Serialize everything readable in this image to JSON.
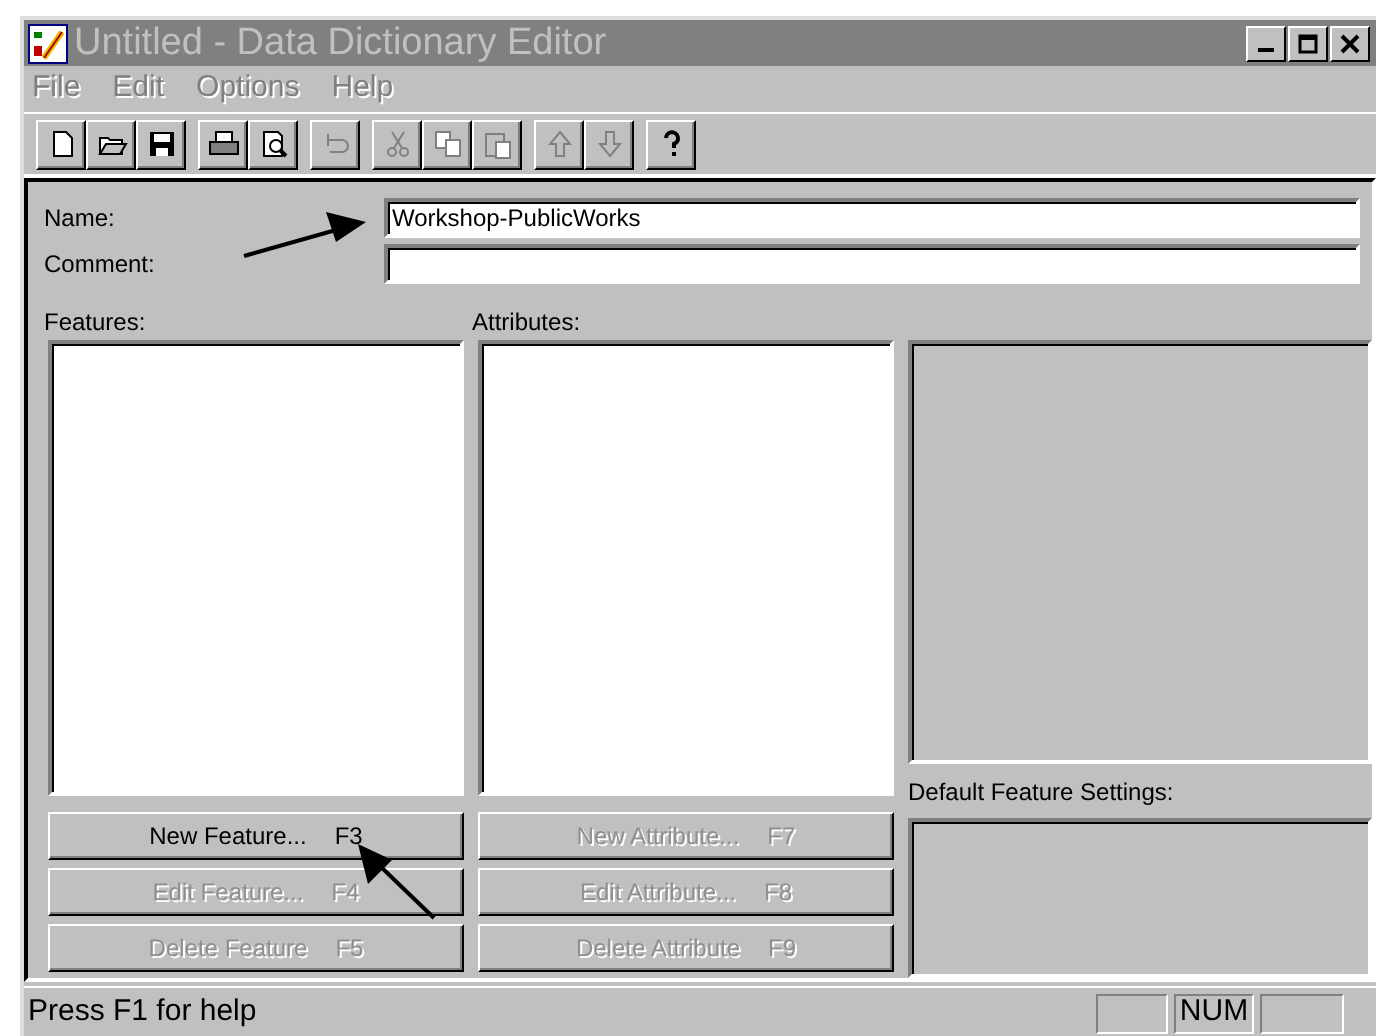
{
  "window": {
    "title": "Untitled - Data Dictionary Editor",
    "active": false
  },
  "menu": [
    {
      "label": "File",
      "disabled": true
    },
    {
      "label": "Edit",
      "disabled": true
    },
    {
      "label": "Options",
      "disabled": true
    },
    {
      "label": "Help",
      "disabled": true
    }
  ],
  "toolbar": [
    {
      "buttons": [
        {
          "kind": "new",
          "disabled": false
        },
        {
          "kind": "open",
          "disabled": false
        },
        {
          "kind": "save",
          "disabled": false
        }
      ]
    },
    {
      "buttons": [
        {
          "kind": "print",
          "disabled": false
        },
        {
          "kind": "preview",
          "disabled": false
        }
      ]
    },
    {
      "buttons": [
        {
          "kind": "undo",
          "disabled": true
        }
      ]
    },
    {
      "buttons": [
        {
          "kind": "cut",
          "disabled": true
        },
        {
          "kind": "copy",
          "disabled": true
        },
        {
          "kind": "paste",
          "disabled": true
        }
      ]
    },
    {
      "buttons": [
        {
          "kind": "up",
          "disabled": true
        },
        {
          "kind": "down",
          "disabled": true
        }
      ]
    },
    {
      "buttons": [
        {
          "kind": "help",
          "disabled": false
        }
      ]
    }
  ],
  "form": {
    "name_label": "Name:",
    "name_value": "Workshop-PublicWorks",
    "comment_label": "Comment:"
  },
  "features": {
    "label": "Features:"
  },
  "attributes": {
    "label": "Attributes:"
  },
  "default_settings": {
    "label": "Default Feature Settings:"
  },
  "feature_buttons": [
    {
      "label": "New Feature...",
      "shortcut": "F3",
      "disabled": false
    },
    {
      "label": "Edit Feature...",
      "shortcut": "F4",
      "disabled": true
    },
    {
      "label": "Delete Feature",
      "shortcut": "F5",
      "disabled": true
    }
  ],
  "attribute_buttons": [
    {
      "label": "New Attribute...",
      "shortcut": "F7",
      "disabled": true
    },
    {
      "label": "Edit Attribute...",
      "shortcut": "F8",
      "disabled": true
    },
    {
      "label": "Delete Attribute",
      "shortcut": "F9",
      "disabled": true
    }
  ],
  "status_bar": {
    "text": "Press F1 for help",
    "indicator": "NUM"
  }
}
